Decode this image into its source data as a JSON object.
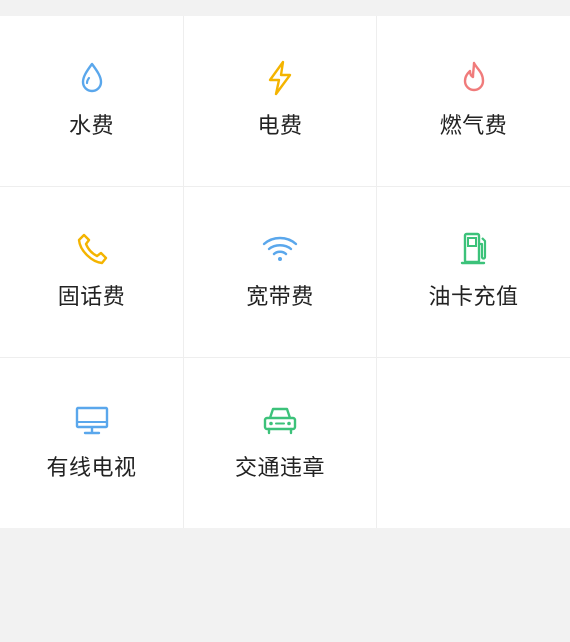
{
  "services": [
    {
      "label": "水费",
      "icon": "water-drop-icon",
      "color": "#5aa7ec"
    },
    {
      "label": "电费",
      "icon": "lightning-icon",
      "color": "#f4b400"
    },
    {
      "label": "燃气费",
      "icon": "flame-icon",
      "color": "#f07b7b"
    },
    {
      "label": "固话费",
      "icon": "phone-icon",
      "color": "#f4b400"
    },
    {
      "label": "宽带费",
      "icon": "wifi-icon",
      "color": "#5aa7ec"
    },
    {
      "label": "油卡充值",
      "icon": "fuel-pump-icon",
      "color": "#3cc27a"
    },
    {
      "label": "有线电视",
      "icon": "tv-monitor-icon",
      "color": "#5aa7ec"
    },
    {
      "label": "交通违章",
      "icon": "car-icon",
      "color": "#3cc27a"
    }
  ]
}
